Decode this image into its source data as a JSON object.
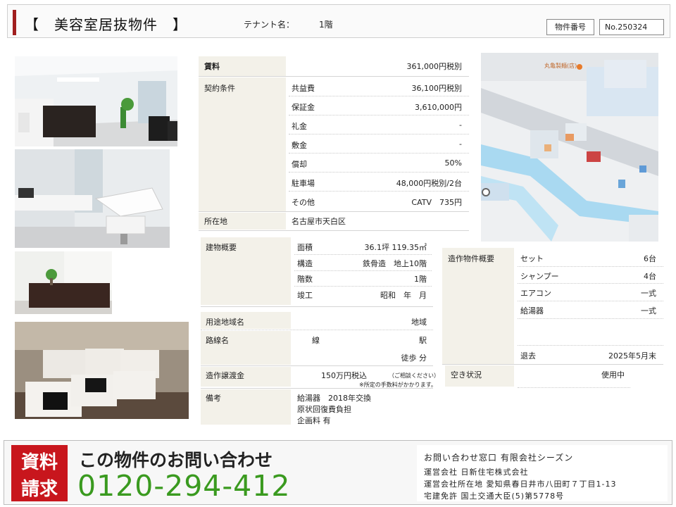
{
  "header": {
    "title": "【　美容室居抜物件　】",
    "tenant_label": "テナント名：",
    "tenant_value": "1階",
    "property_number_label": "物件番号",
    "property_number": "No.250324"
  },
  "rent_table": {
    "rent_label": "賃料",
    "rent_value": "361,000円税別",
    "contract_label": "契約条件",
    "terms": [
      {
        "label": "共益費",
        "value": "36,100円税別"
      },
      {
        "label": "保証金",
        "value": "3,610,000円"
      },
      {
        "label": "礼金",
        "value": "-"
      },
      {
        "label": "敷金",
        "value": "-"
      },
      {
        "label": "償却",
        "value": "50%"
      },
      {
        "label": "駐車場",
        "value": "48,000円税別/2台"
      },
      {
        "label": "その他",
        "value": "CATV　735円"
      }
    ],
    "location_label": "所在地",
    "location_value": "名古屋市天白区"
  },
  "building": {
    "label": "建物概要",
    "rows": [
      {
        "label": "面積",
        "value": "36.1坪 119.35㎡"
      },
      {
        "label": "構造",
        "value": "鉄骨造　地上10階"
      },
      {
        "label": "階数",
        "value": "1階"
      },
      {
        "label": "竣工",
        "value": "昭和　年　月"
      }
    ]
  },
  "zoning": {
    "label": "用途地域名",
    "value": "地域"
  },
  "route": {
    "label": "路線名",
    "line": "線",
    "station": "駅",
    "walk": "徒歩 分"
  },
  "transfer": {
    "label": "造作譲渡金",
    "value": "150万円税込",
    "note1": "（ご相談ください）",
    "note2": "※所定の手数料がかかります。"
  },
  "remarks": {
    "label": "備考",
    "lines": [
      "給湯器　2018年交換",
      "原状回復費負担",
      "企画料 有"
    ]
  },
  "fixtures": {
    "label": "造作物件概要",
    "rows": [
      {
        "label": "セット",
        "value": "6台"
      },
      {
        "label": "シャンプー",
        "value": "4台"
      },
      {
        "label": "エアコン",
        "value": "一式"
      },
      {
        "label": "給湯器",
        "value": "一式"
      }
    ],
    "leave_label": "退去",
    "leave_value": "2025年5月末"
  },
  "vacancy": {
    "label": "空き状況",
    "value": "使用中"
  },
  "map": {
    "label_top": "丸亀製麺(店)"
  },
  "footer": {
    "badge_line1": "資料",
    "badge_line2": "請求",
    "headline": "この物件のお問い合わせ",
    "phone": "0120-294-412",
    "contact_lines": [
      "お問い合わせ窓口 有限会社シーズン",
      "運営会社 日新住宅株式会社",
      "運営会社所在地 愛知県春日井市八田町７丁目1-13",
      "宅建免許 国土交通大臣(5)第5778号"
    ]
  }
}
